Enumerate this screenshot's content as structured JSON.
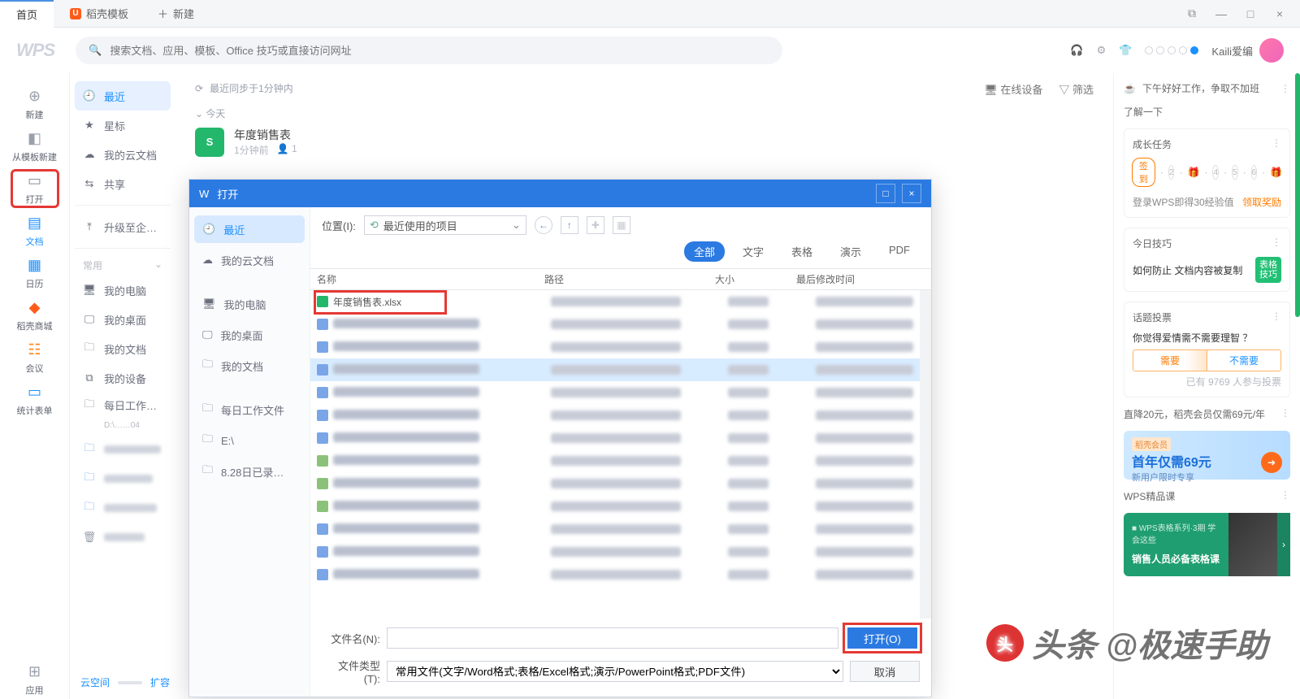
{
  "tabs": {
    "home": "首页",
    "docker": "稻壳模板",
    "new": "新建"
  },
  "window": {
    "min": "—",
    "max": "□",
    "close": "×",
    "extra": "⧉"
  },
  "search": {
    "placeholder": "搜索文档、应用、模板、Office 技巧或直接访问网址"
  },
  "user": {
    "name": "Kaili爱编"
  },
  "railL": {
    "new": "新建",
    "from_tpl": "从模板新建",
    "open": "打开",
    "docs": "文档",
    "calendar": "日历",
    "docker": "稻壳商城",
    "meeting": "会议",
    "forms": "统计表单",
    "apps": "应用"
  },
  "col2": {
    "recent": "最近",
    "star": "星标",
    "cloud": "我的云文档",
    "share": "共享",
    "upgrade": "升级至企…",
    "commonHdr": "常用",
    "computer": "我的电脑",
    "desktop": "我的桌面",
    "documents": "我的文档",
    "devices": "我的设备",
    "daily": "每日工作…",
    "dailySub": "D:\\……04",
    "cloudspace": "云空间",
    "expand": "扩容"
  },
  "center": {
    "sync": "最近同步于1分钟内",
    "today": "今天",
    "online": "在线设备",
    "filter": "筛选",
    "file": {
      "name": "年度销售表",
      "time": "1分钟前",
      "people": "1"
    }
  },
  "railR": {
    "greet": "下午好好工作，争取不加班",
    "learn": "了解一下",
    "growHdr": "成长任务",
    "checkin": "签到",
    "loginTip": "登录WPS即得30经验值",
    "getReward": "领取奖励",
    "todayTip": "今日技巧",
    "tipText": "如何防止 文档内容被复制",
    "tipBadge": "表格技巧",
    "voteHdr": "话题投票",
    "voteQ": "你觉得爱情需不需要理智 ？",
    "voteYes": "需要",
    "voteNo": "不需要",
    "voteMetaA": "已有",
    "voteMetaB": "人参与投票",
    "voteCount": "9769",
    "promoHdr": "直降20元，稻壳会员仅需69元/年",
    "promoTag": "稻壳会员",
    "promoBig": "首年仅需69元",
    "promoSm": "新用户限时专享",
    "courseHdr": "WPS精品课",
    "courseTxt": "销售人员必备表格课"
  },
  "dialog": {
    "title": "打开",
    "locLabel": "位置(I):",
    "locValue": "最近使用的项目",
    "side": {
      "recent": "最近",
      "cloud": "我的云文档",
      "computer": "我的电脑",
      "desktop": "我的桌面",
      "documents": "我的文档",
      "daily": "每日工作文件",
      "e": "E:\\",
      "date": "8.28日已录…"
    },
    "filters": {
      "all": "全部",
      "word": "文字",
      "excel": "表格",
      "ppt": "演示",
      "pdf": "PDF"
    },
    "cols": {
      "name": "名称",
      "path": "路径",
      "size": "大小",
      "date": "最后修改时间"
    },
    "firstFile": "年度销售表.xlsx",
    "fileNameLbl": "文件名(N):",
    "fileTypeLbl": "文件类型(T):",
    "fileType": "常用文件(文字/Word格式;表格/Excel格式;演示/PowerPoint格式;PDF文件)",
    "open": "打开(O)",
    "cancel": "取消"
  },
  "watermark": "头条 @极速手助"
}
